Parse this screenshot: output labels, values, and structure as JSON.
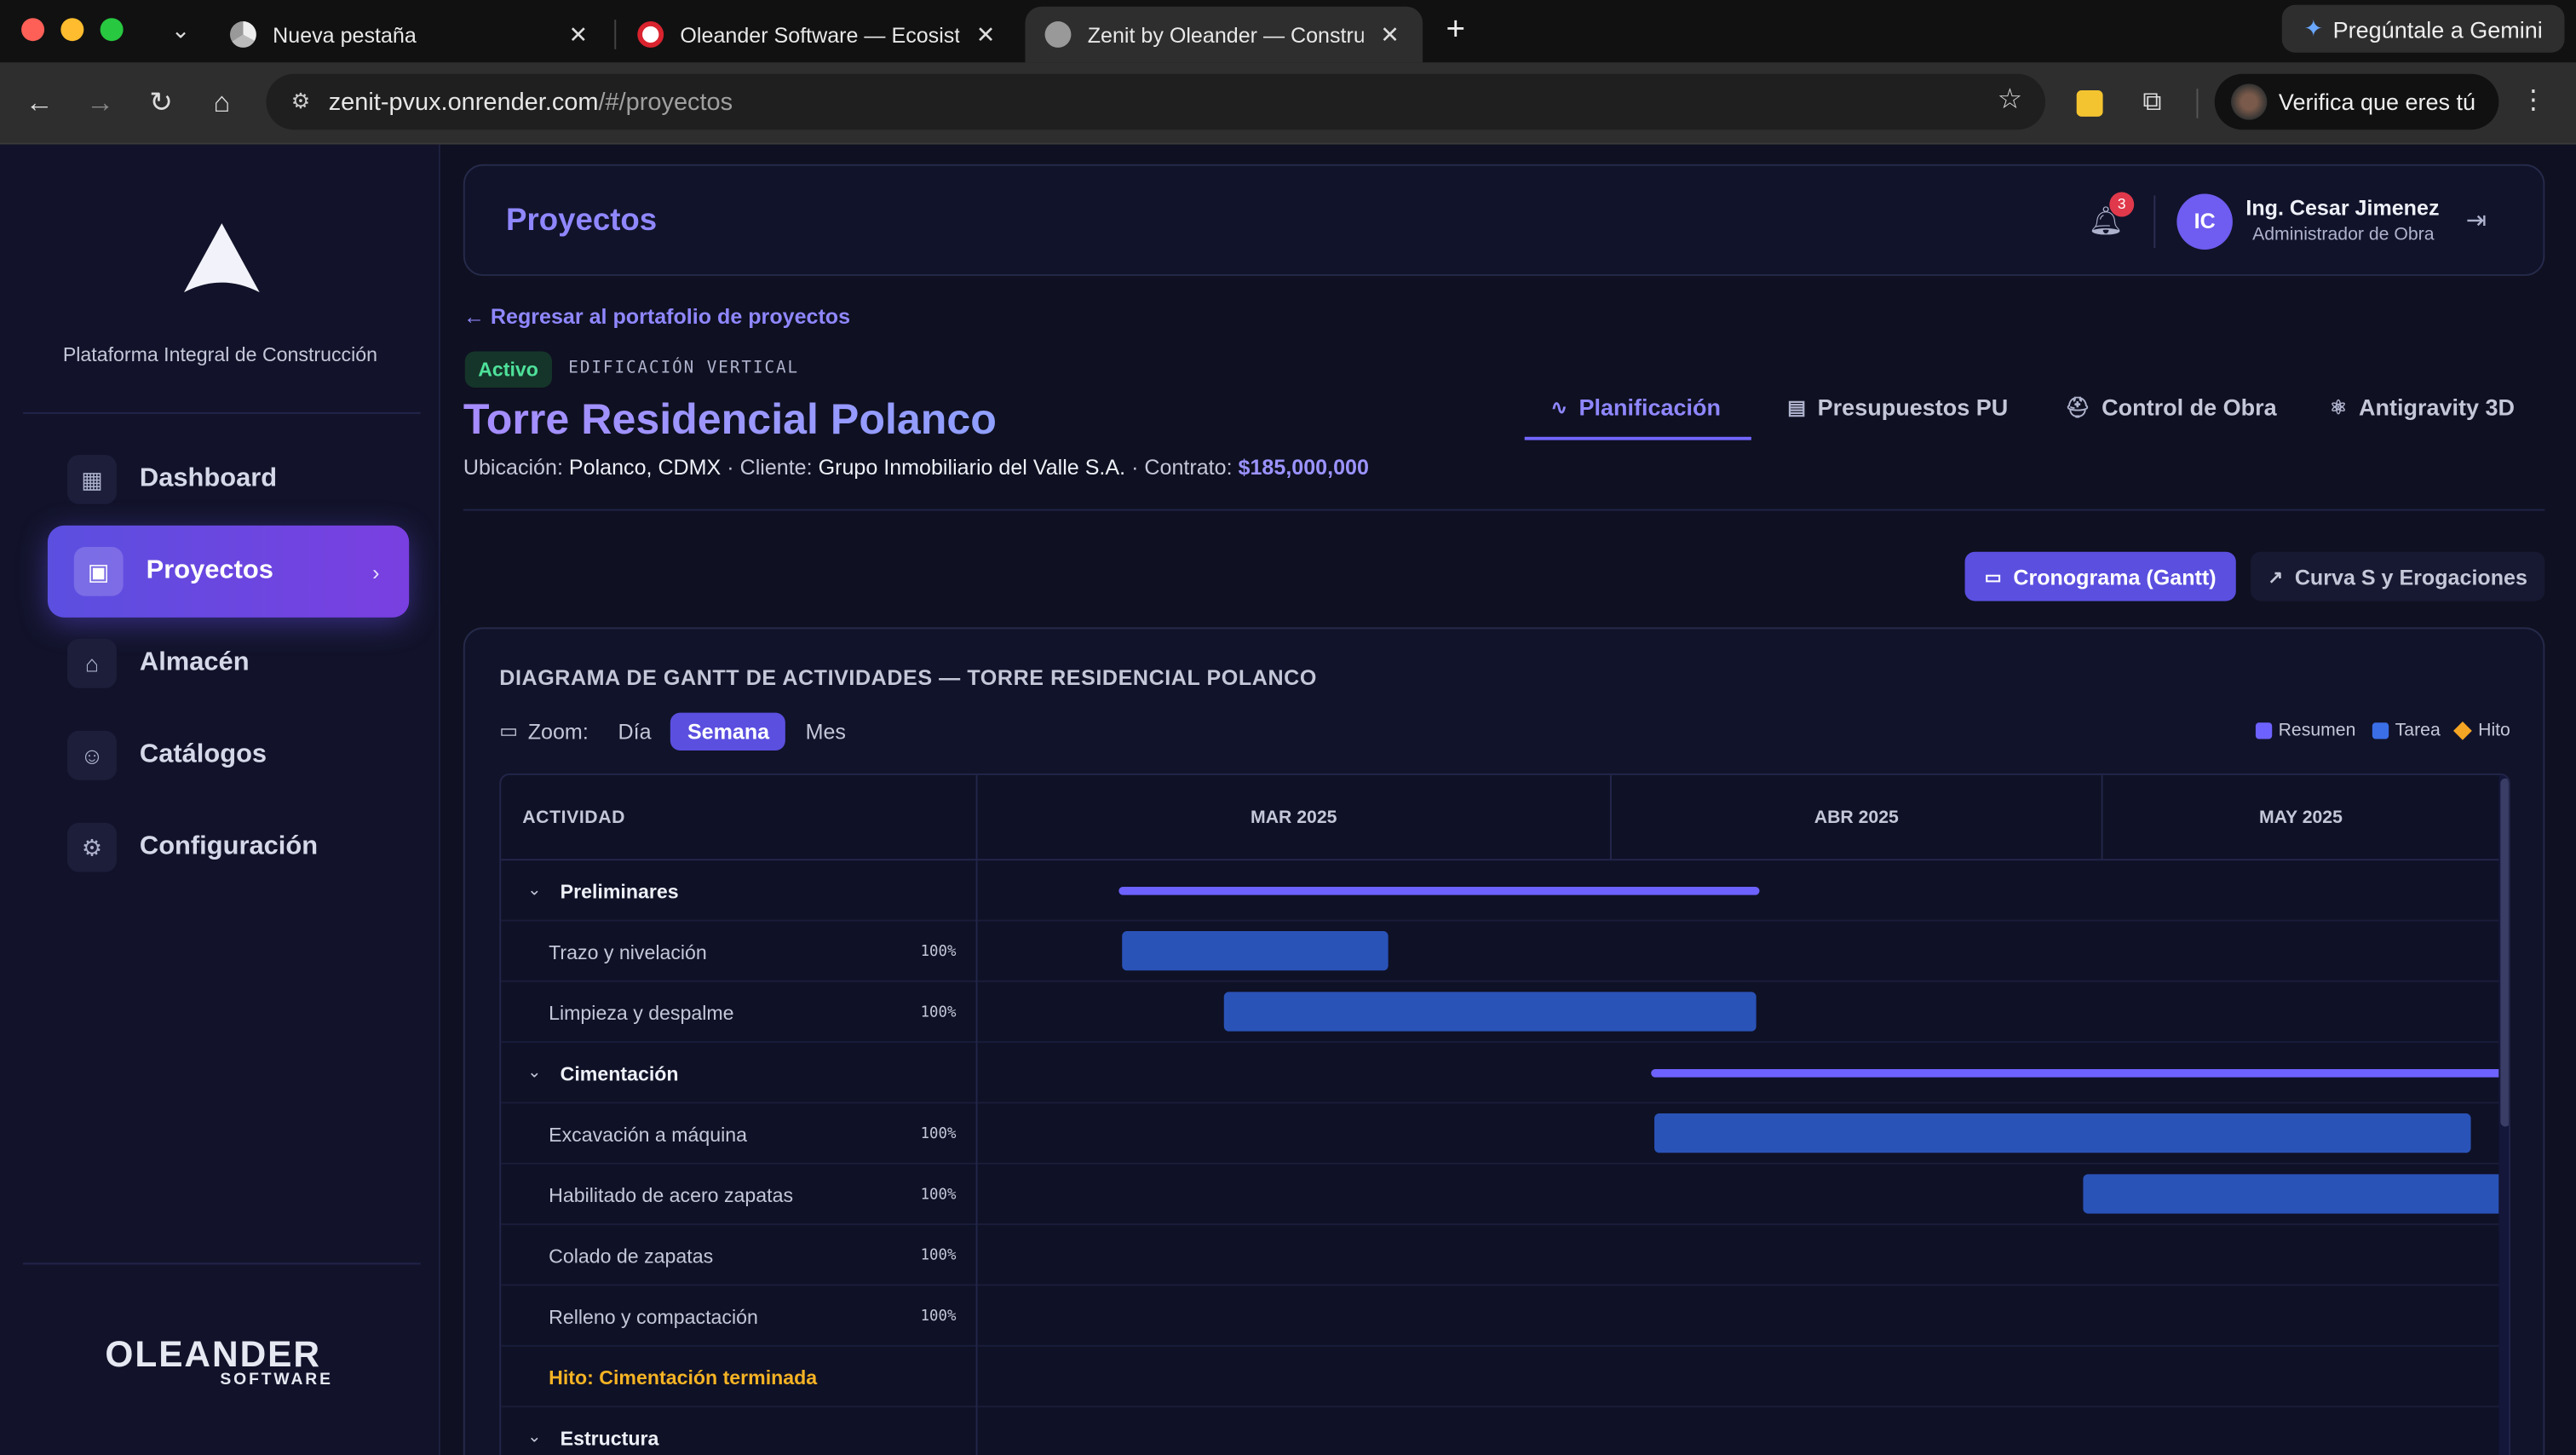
{
  "browser": {
    "tabs": [
      {
        "title": "Nueva pestaña",
        "icon": "chrome-icon"
      },
      {
        "title": "Oleander Software — Ecosistema",
        "icon": "oleander-favicon"
      },
      {
        "title": "Zenit by Oleander — Construcción",
        "icon": "globe-icon"
      }
    ],
    "gemini_label": "Pregúntale a Gemini",
    "url_host": "zenit-pvux.onrender.com",
    "url_path": "/#/proyectos",
    "verify_label": "Verifica que eres tú"
  },
  "sidebar": {
    "platform_label": "Plataforma Integral de Construcción",
    "items": [
      {
        "label": "Dashboard",
        "icon": "dashboard-icon"
      },
      {
        "label": "Proyectos",
        "icon": "folder-icon"
      },
      {
        "label": "Almacén",
        "icon": "warehouse-icon"
      },
      {
        "label": "Catálogos",
        "icon": "users-icon"
      },
      {
        "label": "Configuración",
        "icon": "gear-icon"
      }
    ],
    "brand_main": "OLEANDER",
    "brand_sub": "SOFTWARE"
  },
  "header": {
    "title": "Proyectos",
    "notifications": "3",
    "user_initials": "IC",
    "user_name": "Ing. Cesar Jimenez",
    "user_role": "Administrador de Obra"
  },
  "project": {
    "back_label": "Regresar al portafolio de proyectos",
    "status": "Activo",
    "type": "EDIFICACIÓN VERTICAL",
    "name": "Torre Residencial Polanco",
    "location_label": "Ubicación:",
    "location": "Polanco, CDMX",
    "client_label": "· Cliente:",
    "client": "Grupo Inmobiliario del Valle S.A.",
    "contract_label": "· Contrato:",
    "contract": "$185,000,000",
    "tabs": [
      "Planificación",
      "Presupuestos PU",
      "Control de Obra",
      "Antigravity 3D"
    ],
    "views": [
      "Cronograma (Gantt)",
      "Curva S y Erogaciones"
    ]
  },
  "gantt": {
    "title": "DIAGRAMA DE GANTT DE ACTIVIDADES — TORRE RESIDENCIAL POLANCO",
    "zoom_label": "Zoom:",
    "zoom_options": [
      "Día",
      "Semana",
      "Mes"
    ],
    "zoom_selected": "Semana",
    "legend": [
      "Resumen",
      "Tarea",
      "Hito"
    ],
    "colors": {
      "summary": "#6d62ff",
      "task": "#3b6fe8",
      "milestone": "#f5a524"
    },
    "activity_header": "ACTIVIDAD",
    "months": [
      "MAR 2025",
      "ABR 2025",
      "MAY 2025"
    ],
    "rows": [
      {
        "kind": "group",
        "name": "Preliminares"
      },
      {
        "kind": "task",
        "name": "Trazo y nivelación",
        "progress": "100%"
      },
      {
        "kind": "task",
        "name": "Limpieza y despalme",
        "progress": "100%"
      },
      {
        "kind": "group",
        "name": "Cimentación"
      },
      {
        "kind": "task",
        "name": "Excavación a máquina",
        "progress": "100%"
      },
      {
        "kind": "task",
        "name": "Habilitado de acero zapatas",
        "progress": "100%"
      },
      {
        "kind": "task",
        "name": "Colado de zapatas",
        "progress": "100%"
      },
      {
        "kind": "task",
        "name": "Relleno y compactación",
        "progress": "100%"
      },
      {
        "kind": "milestone",
        "name": "Hito: Cimentación terminada"
      },
      {
        "kind": "group",
        "name": "Estructura"
      }
    ]
  }
}
